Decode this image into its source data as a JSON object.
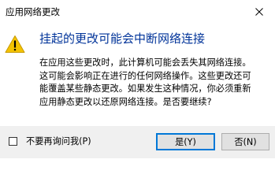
{
  "window": {
    "title": "应用网络更改",
    "close_icon": "close-icon"
  },
  "message": {
    "icon": "warning-icon",
    "icon_color": "#f4c300",
    "main_instruction": "挂起的更改可能会中断网络连接",
    "main_instruction_color": "#003399",
    "body_lines": [
      "在应用这些更改时，此计算机可能会丢失其网络连接。",
      "这可能会影响正在进行的任何网络操作。这些更改还可",
      "能覆盖某些静态更改。如果发生这种情况，你必须重新",
      "应用静态更改以还原网络连接。是否要继续?"
    ]
  },
  "footer": {
    "checkbox_label": "不要再询问我(P)",
    "checkbox_checked": false,
    "yes_label": "是(Y)",
    "no_label": "否(N)",
    "accent_color": "#0078d7"
  }
}
